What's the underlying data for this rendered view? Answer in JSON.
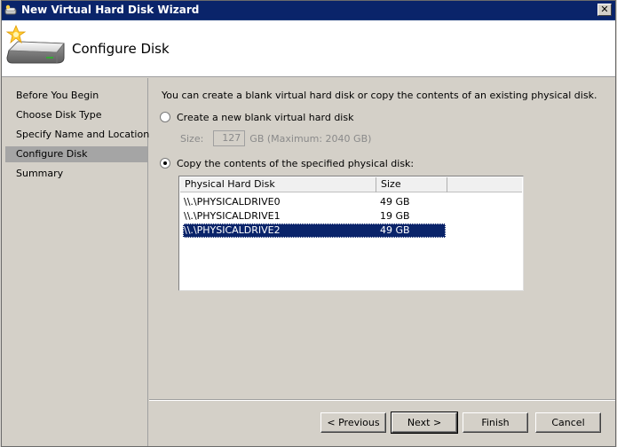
{
  "window": {
    "title": "New Virtual Hard Disk Wizard",
    "close_glyph": "✕"
  },
  "header": {
    "page_title": "Configure Disk",
    "icon": "hard-disk-sparkle-icon"
  },
  "sidebar": {
    "items": [
      {
        "label": "Before You Begin",
        "active": false
      },
      {
        "label": "Choose Disk Type",
        "active": false
      },
      {
        "label": "Specify Name and Location",
        "active": false
      },
      {
        "label": "Configure Disk",
        "active": true
      },
      {
        "label": "Summary",
        "active": false
      }
    ]
  },
  "content": {
    "intro": "You can create a blank virtual hard disk or copy the contents of an existing physical disk.",
    "option_blank": {
      "label": "Create a new blank virtual hard disk",
      "checked": false
    },
    "size": {
      "label": "Size:",
      "value": "127",
      "suffix": "GB (Maximum: 2040 GB)",
      "disabled": true
    },
    "option_copy": {
      "label": "Copy the contents of the specified physical disk:",
      "checked": true
    },
    "disk_list": {
      "columns": [
        "Physical Hard Disk",
        "Size"
      ],
      "rows": [
        {
          "name": "\\\\.\\PHYSICALDRIVE0",
          "size": "49 GB",
          "selected": false
        },
        {
          "name": "\\\\.\\PHYSICALDRIVE1",
          "size": "19 GB",
          "selected": false
        },
        {
          "name": "\\\\.\\PHYSICALDRIVE2",
          "size": "49 GB",
          "selected": true
        }
      ]
    }
  },
  "buttons": {
    "previous": "< Previous",
    "next": "Next >",
    "finish": "Finish",
    "cancel": "Cancel"
  },
  "colors": {
    "titlebar": "#0a246a",
    "selection": "#0a246a",
    "sidebar_active": "#a5a5a5",
    "dialog_face": "#d4d0c8"
  }
}
